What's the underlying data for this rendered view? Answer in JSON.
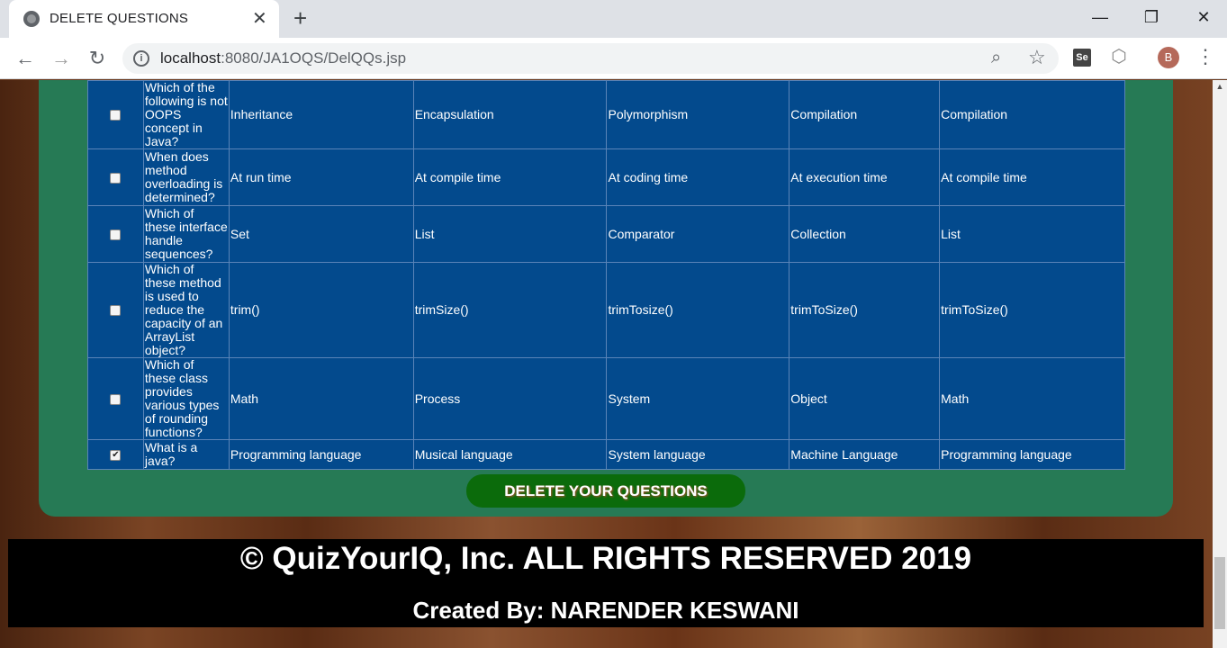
{
  "browser": {
    "tab_title": "DELETE QUESTIONS",
    "tab_close": "✕",
    "new_tab": "+",
    "url_host": "localhost",
    "url_path": ":8080/JA1OQS/DelQQs.jsp",
    "avatar_letter": "B",
    "ext_label": "Se",
    "window_minimize": "—",
    "window_restore": "❐",
    "window_close": "✕"
  },
  "table": {
    "rows": [
      {
        "checked": false,
        "question": "Which of the following is not OOPS concept in Java?",
        "options": [
          "Inheritance",
          "Encapsulation",
          "Polymorphism",
          "Compilation"
        ],
        "answer": "Compilation"
      },
      {
        "checked": false,
        "question": "When does method overloading is determined?",
        "options": [
          "At run time",
          "At compile time",
          "At coding time",
          "At execution time"
        ],
        "answer": "At compile time"
      },
      {
        "checked": false,
        "question": "Which of these interface handle sequences?",
        "options": [
          "Set",
          "List",
          "Comparator",
          "Collection"
        ],
        "answer": "List"
      },
      {
        "checked": false,
        "question": "Which of these method is used to reduce the capacity of an ArrayList object?",
        "options": [
          "trim()",
          "trimSize()",
          "trimTosize()",
          "trimToSize()"
        ],
        "answer": "trimToSize()"
      },
      {
        "checked": false,
        "question": "Which of these class provides various types of rounding functions?",
        "options": [
          "Math",
          "Process",
          "System",
          "Object"
        ],
        "answer": "Math"
      },
      {
        "checked": true,
        "question": "What is a java?",
        "options": [
          "Programming language",
          "Musical language",
          "System language",
          "Machine Language"
        ],
        "answer": "Programming language"
      }
    ]
  },
  "actions": {
    "delete_label": "DELETE YOUR QUESTIONS"
  },
  "footer": {
    "copyright": "© QuizYourIQ, Inc. ALL RIGHTS RESERVED 2019",
    "credits": "Created By: NARENDER KESWANI"
  }
}
